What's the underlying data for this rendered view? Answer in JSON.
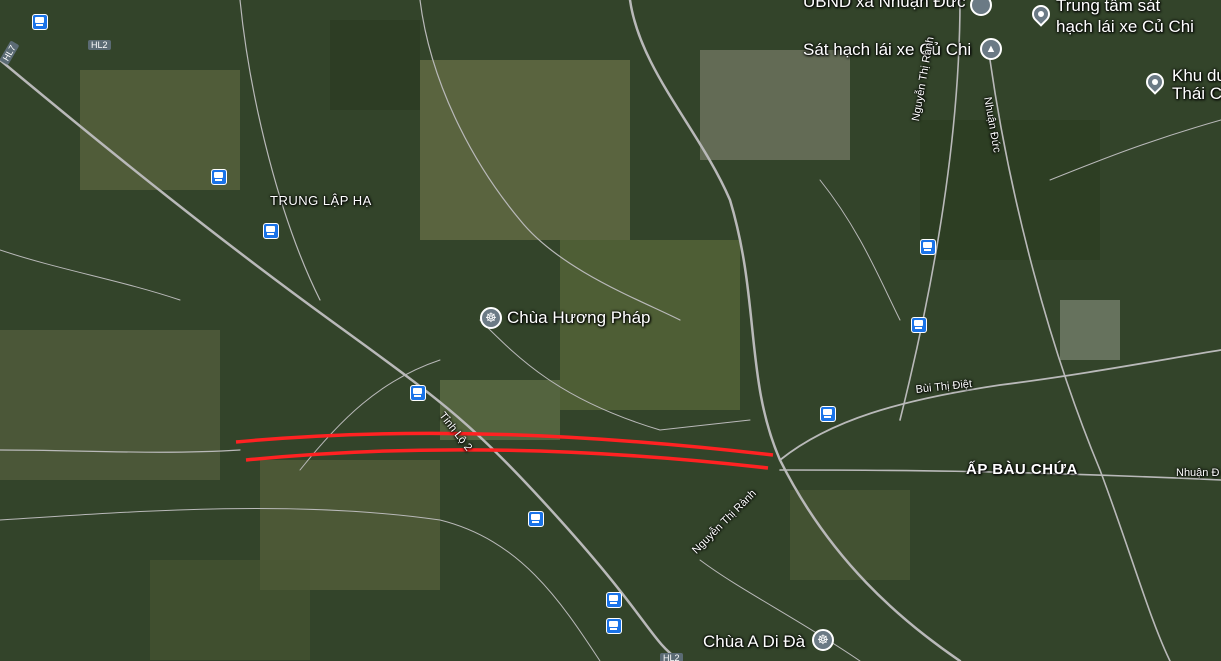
{
  "map": {
    "colors": {
      "vegetation": "#2f3f24",
      "field": "#6a7248",
      "road": "#b8b8b8",
      "highlight": "#ff2222",
      "bus_stop": "#1a73e8",
      "poi_pin": "#6b7a85"
    },
    "pois": [
      {
        "label": "UBND xã Nhuận Đức",
        "icon": "pin-icon"
      },
      {
        "label": "Trung tâm sát",
        "icon": "pin-icon"
      },
      {
        "label": "hạch lái xe Củ Chi",
        "icon": "none"
      },
      {
        "label": "Sát hạch lái xe Củ Chi",
        "icon": "graduation-cap-icon"
      },
      {
        "label": "Khu du",
        "icon": "pin-icon"
      },
      {
        "label": "Thái C",
        "icon": "none"
      },
      {
        "label": "Chùa Hương Pháp",
        "icon": "dharma-wheel-icon"
      },
      {
        "label": "Chùa A Di Đà",
        "icon": "dharma-wheel-icon"
      }
    ],
    "areas": [
      {
        "label": "TRUNG LẬP HẠ"
      },
      {
        "label": "ẤP BÀU CHỨA"
      }
    ],
    "roads": [
      {
        "label": "Nguyễn Thị Rành"
      },
      {
        "label": "Nhuận Đức"
      },
      {
        "label": "Bùi Thị Điệt"
      },
      {
        "label": "Nhuận Đ"
      },
      {
        "label": "Nguyễn Thị Rành"
      },
      {
        "label": "Tỉnh Lộ 2"
      }
    ],
    "shields": [
      "HL2",
      "HL7",
      "HL2"
    ]
  }
}
